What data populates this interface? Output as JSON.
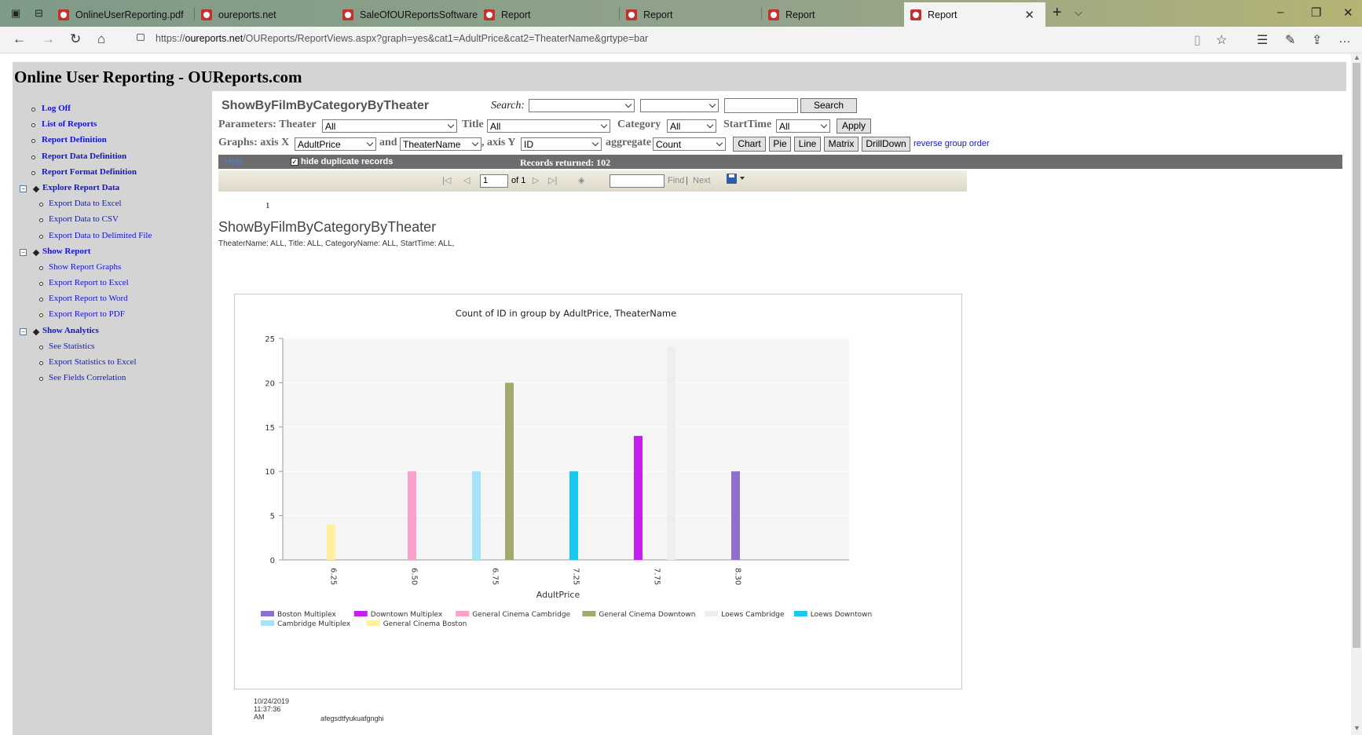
{
  "browser": {
    "tabs": [
      {
        "label": "OnlineUserReporting.pdf"
      },
      {
        "label": "oureports.net"
      },
      {
        "label": "SaleOfOUReportsSoftware.p"
      },
      {
        "label": "Report"
      },
      {
        "label": "Report"
      },
      {
        "label": "Report"
      },
      {
        "label": "Report",
        "active": true
      }
    ],
    "url_prefix": "https://",
    "url_host": "oureports.net",
    "url_path": "/OUReports/ReportViews.aspx?graph=yes&cat1=AdultPrice&cat2=TheaterName&grtype=bar"
  },
  "page": {
    "header": "Online User Reporting - OUReports.com"
  },
  "sidebar": {
    "items": [
      {
        "label": "Log Off",
        "level": 1
      },
      {
        "label": "List of Reports",
        "level": 1
      },
      {
        "label": "Report Definition",
        "level": 1
      },
      {
        "label": "Report Data Definition",
        "level": 1
      },
      {
        "label": "Report Format Definition",
        "level": 1
      },
      {
        "label": "Explore Report Data",
        "level": 0
      },
      {
        "label": "Export Data to Excel",
        "level": 2
      },
      {
        "label": "Export Data to CSV",
        "level": 2
      },
      {
        "label": "Export Data to Delimited File",
        "level": 2
      },
      {
        "label": "Show Report",
        "level": 0
      },
      {
        "label": "Show Report Graphs",
        "level": 2
      },
      {
        "label": "Export Report to Excel",
        "level": 2
      },
      {
        "label": "Export Report to Word",
        "level": 2
      },
      {
        "label": "Export Report to PDF",
        "level": 2
      },
      {
        "label": "Show Analytics",
        "level": 0
      },
      {
        "label": "See Statistics",
        "level": 2
      },
      {
        "label": "Export Statistics to Excel",
        "level": 2
      },
      {
        "label": "See Fields Correlation",
        "level": 2
      }
    ]
  },
  "report": {
    "name": "ShowByFilmByCategoryByTheater",
    "search_label": "Search:",
    "search_button": "Search",
    "params_label": "Parameters: Theater",
    "theater_value": "All",
    "title_label": "Title",
    "title_value": "All",
    "category_label": "Category",
    "category_value": "All",
    "starttime_label": "StartTime",
    "starttime_value": "All",
    "apply_button": "Apply",
    "graphs_label": "Graphs: axis X",
    "axis_x_value": "AdultPrice",
    "and_label": "and",
    "axis_x2_value": "TheaterName",
    "axis_y_label": ", axis Y",
    "axis_y_value": "ID",
    "aggregate_label": "aggregate",
    "aggregate_value": "Count",
    "chart_button": "Chart",
    "pie_button": "Pie",
    "line_button": "Line",
    "matrix_button": "Matrix",
    "drilldown_button": "DrillDown",
    "reverse_link": "reverse group order",
    "help_link": "Help",
    "hide_duplicates": "hide duplicate records",
    "records_returned": "Records returned: 102",
    "page_input": "1",
    "of_label": "of 1",
    "find_label": "Find",
    "separator": "|",
    "next_label": "Next",
    "page_number": "1",
    "title_text": "ShowByFilmByCategoryByTheater",
    "params_text": "TheaterName:   ALL, Title:   ALL, CategoryName:   ALL, StartTime:   ALL,",
    "timestamp": "10/24/2019 11:37:36 AM",
    "footer_text": "afegsdtfyukuafgnghi"
  },
  "colors": {
    "Boston Multiplex": "#8e6fd0",
    "Downtown Multiplex": "#c31ff0",
    "General Cinema Cambridge": "#fb9fcb",
    "General Cinema Downtown": "#a3a86e",
    "Loews Cambridge": "#eeeeee",
    "Loews Downtown": "#17c9ef",
    "Cambridge Multiplex": "#a5e4f8",
    "General Cinema Boston": "#fff0a0"
  },
  "chart_data": {
    "type": "bar",
    "title": "Count of ID in group by AdultPrice, TheaterName",
    "xlabel": "AdultPrice",
    "ylabel": "",
    "ylim": [
      0,
      25
    ],
    "yticks": [
      0,
      5,
      10,
      15,
      20,
      25
    ],
    "categories": [
      "6.25",
      "6.50",
      "6.75",
      "7.25",
      "7.75",
      "8.30"
    ],
    "grid": true,
    "legend_position": "bottom",
    "legend": [
      "Boston Multiplex",
      "Downtown Multiplex",
      "General Cinema Cambridge",
      "General Cinema Downtown",
      "Loews Cambridge",
      "Loews Downtown",
      "Cambridge Multiplex",
      "General Cinema Boston"
    ],
    "bars": [
      {
        "category": "6.25",
        "series": "General Cinema Boston",
        "value": 4
      },
      {
        "category": "6.50",
        "series": "General Cinema Cambridge",
        "value": 10
      },
      {
        "category": "6.75",
        "series": "Cambridge Multiplex",
        "value": 10
      },
      {
        "category": "6.75",
        "series": "General Cinema Downtown",
        "value": 20
      },
      {
        "category": "7.25",
        "series": "Loews Downtown",
        "value": 10
      },
      {
        "category": "7.75",
        "series": "Downtown Multiplex",
        "value": 14
      },
      {
        "category": "7.75",
        "series": "Loews Cambridge",
        "value": 24
      },
      {
        "category": "8.30",
        "series": "Boston Multiplex",
        "value": 10
      }
    ]
  }
}
